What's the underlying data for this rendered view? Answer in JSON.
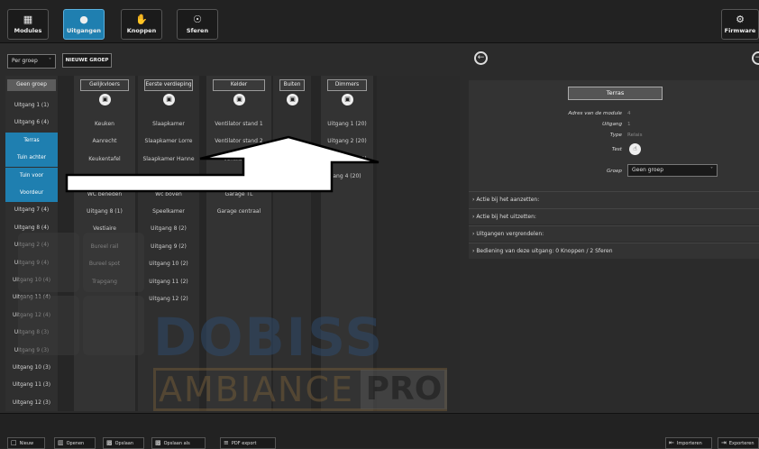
{
  "toolbar": {
    "modules": "Modules",
    "outputs": "Uitgangen",
    "buttons": "Knoppen",
    "spheres": "Sferen",
    "firmware": "Firmware"
  },
  "filter": {
    "group_select": "Per groep",
    "new_group": "NIEUWE GROEP"
  },
  "groups_column": {
    "header": "Geen groep",
    "items": [
      "Uitgang 1 (1)",
      "Uitgang 6 (4)",
      "Terras",
      "Tuin achter",
      "Tuin voor",
      "Voordeur",
      "Uitgang 7 (4)",
      "Uitgang 8 (4)",
      "Uitgang 2 (4)",
      "Uitgang 9 (4)",
      "Uitgang 10 (4)",
      "Uitgang 11 (4)",
      "Uitgang 12 (4)",
      "Uitgang 8 (3)",
      "Uitgang 9 (3)",
      "Uitgang 10 (3)",
      "Uitgang 11 (3)",
      "Uitgang 12 (3)"
    ]
  },
  "group_cols": [
    {
      "name": "Gelijkvloers",
      "items": [
        "Keuken",
        "Aanrecht",
        "Keukentafel",
        "",
        "WC beneden",
        "Uitgang 8 (1)",
        "Vestiaire",
        "Bureel rail",
        "Bureel spot",
        "Trapgang"
      ]
    },
    {
      "name": "Eerste verdieping",
      "items": [
        "Slaapkamer",
        "Slaapkamer Lorre",
        "Slaapkamer Hanne",
        "",
        "Wc boven",
        "Speelkamer",
        "Uitgang 8 (2)",
        "Uitgang 9 (2)",
        "Uitgang 10 (2)",
        "Uitgang 11 (2)",
        "Uitgang 12 (2)"
      ]
    },
    {
      "name": "Kelder",
      "items": [
        "Ventilator stand 1",
        "Ventilator stand 2",
        "Ventilator s",
        "",
        "Garage TL",
        "Garage centraal"
      ]
    },
    {
      "name": "Buiten",
      "items": []
    },
    {
      "name": "Dimmers",
      "items": [
        "Uitgang 1 (20)",
        "Uitgang 2 (20)",
        "Uitgang 3 (20)",
        "ang 4 (20)"
      ]
    }
  ],
  "watermark": {
    "line1": "DOBISS",
    "line2": "AMBIANCE",
    "pro": "PRO"
  },
  "detail": {
    "title": "Terras",
    "props": [
      {
        "label": "Adres van de module",
        "value": "4"
      },
      {
        "label": "Uitgang",
        "value": "1"
      },
      {
        "label": "Type",
        "value": "Relais"
      },
      {
        "label": "Test",
        "value": ""
      },
      {
        "label": "Groep",
        "value": "Geen groep"
      }
    ],
    "accordion": [
      "Actie bij het aanzetten:",
      "Actie bij het uitzetten:",
      "Uitgangen vergrendelen:",
      "Bediening van deze uitgang: 0 Knoppen / 2 Sferen"
    ]
  },
  "bottombar": {
    "new": "Nieuw",
    "open": "Openen",
    "save": "Opslaan",
    "save_as": "Opslaan als",
    "pdf": "PDF export",
    "import": "Importeren",
    "export": "Exporteren"
  },
  "icons": {
    "modules": "grid-icon",
    "outputs": "bulb-icon",
    "buttons": "hand-icon",
    "spheres": "spinner-icon",
    "firmware": "gear-icon"
  }
}
